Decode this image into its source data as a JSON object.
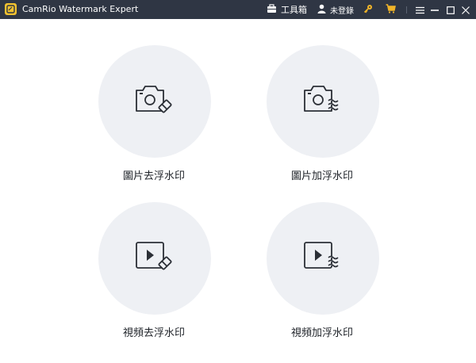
{
  "app": {
    "title": "CamRio Watermark Expert"
  },
  "toolbar": {
    "toolbox_label": "工具箱",
    "account_label": "未登錄"
  },
  "colors": {
    "titlebar": "#2f3644",
    "logo": "#f2c230",
    "key_icon": "#f0b429",
    "cart_icon": "#f0b429",
    "circle_bg": "#eef0f4"
  },
  "cards": [
    {
      "label": "圖片去浮水印",
      "icon": "camera-eraser-icon"
    },
    {
      "label": "圖片加浮水印",
      "icon": "camera-waves-icon"
    },
    {
      "label": "視頻去浮水印",
      "icon": "video-eraser-icon"
    },
    {
      "label": "視頻加浮水印",
      "icon": "video-waves-icon"
    }
  ]
}
